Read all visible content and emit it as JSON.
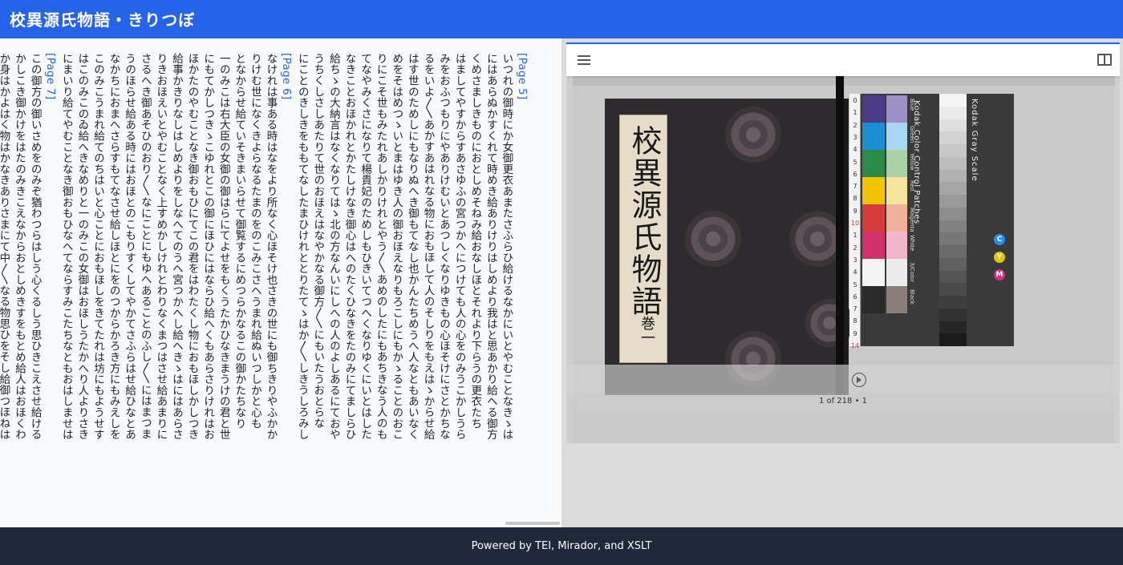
{
  "header": {
    "title": "校異源氏物語・きりつぼ"
  },
  "text": {
    "page5_label": "[Page 5]",
    "page6_label": "[Page 6]",
    "page7_label": "[Page 7]",
    "page5_lines": [
      "いつれの御時にか女御更衣あまたさふらひ給けるなかにいとやむことなきゝは",
      "にはあらぬかすくれて時めき給ありけりはしめより我はと思あかり給へる御方",
      "くめさましきものにおとしめそねみ給おなしほとそれより下らうの更衣たち",
      "はましてやすからすあさゆふの宮つかへにつけても人の心をのみうこかしうら",
      "みをおふつもりにやありけむいとあつしくなりゆきもの心ほそけにさとかちな",
      "るをいよ〳〵あかすあはれなる物におもほして人のそしりをもえはゝからせ給",
      "はす世のためしにもなりぬへき御もてなし也かんたちめうへ人なともあいなく",
      "めをそはめつゝいとまはゆき人の御おほえなりもろこしにもかゝることのおこ",
      "りにこそ世もみたれあしかりけれとやう〳〵あめのしたにもあちきなう人のも",
      "てなやみくさになりて楊貴妃のためしもひきいてつへくなりゆくにいとはした",
      "なきことおほかれとかたしけなき御心はへのたくひなきをたのみにてましらひ",
      "給ちゝの大納言はなくなりてはゝ北の方なんいにしへの人のよしあるにておや",
      "うちくしさしあたりて世のおほえはなやかなる御方〳〵にもいたうおとらな",
      "にことのきしきをももてなしたまひけれととりたてゝはか〳〵しきうしろみし"
    ],
    "page6_lines": [
      "なけれは事ある時はなをより所なく心ほそけ也さきの世にも御ちきりやふかか",
      "りけむ世になくきよらなるたまのをのこみこさへうまれ給ぬいつしかと心も",
      "となからせ給ていそきまいらせて御覧するにめつらかなるこの御かたちなり",
      "一のみこは右大臣の女御の御はらにてよせをもくうたかひなきまうけの君と世",
      "にもてかしつきゝこゆれとこの御にほひにはならひ給へくもあらさりけれはお",
      "ほかたのやむことなき御おもひにてこの君をはわたくし物におもほしかしつき",
      "給事かきりなしはしめよりをしなへてのうへ宮つかへし給へきゝはにはあらさ",
      "りきおほえいとやむことなく上すめかしけれとわりなくまつはさせ給あまりに",
      "さるへき御あそひのおり〳〵なにことにもゆへあることのふし〳〵にはまつま",
      "うのほらせ給ある時にはおほとのこもりすくしてやかてさふらはせ給ひなとあ",
      "なかちにおまへさらすもてなさせ給しほとにをのつからかろき方にもみえしを",
      "このみこうまれ給てのちはいと心ことにおもほしをきてたれは坊にもようせす",
      "はこのみこのゐ給へきなめりと一のみこの女御はおほしうたかへり人よりさき",
      "にまいり給てやむことなき御おもひなへてならすみこたちなともおはしませは"
    ],
    "page7_lines": [
      "この御方の御いさめをのみぞ猶わつらはしう心くるしう思ひきこえさせ給ける",
      "かしこき御かけをはたのみきこえなからおとしめきすをもとめ給人はおほくわ",
      "か身はかよはく物はかなきありさまにて中〳〵なる物思ひをそし給御つほねは"
    ]
  },
  "viewer": {
    "book_title": "校異源氏物語",
    "book_volume": "巻一",
    "target_kodak_gray": "Kodak Gray Scale",
    "target_kodak_color": "Kodak Color Control Patches",
    "ruler_ticks": [
      "0",
      "1",
      "2",
      "3",
      "4",
      "5",
      "6",
      "7",
      "8",
      "9",
      "10",
      "1",
      "2",
      "3",
      "4",
      "5",
      "6",
      "7",
      "8",
      "9",
      "14"
    ],
    "patch_labels": [
      "Blue",
      "Green",
      "Yellow",
      "Red",
      "Magenta",
      "White",
      "3/Color",
      "Black"
    ],
    "cym_labels": [
      "C",
      "Y",
      "M"
    ],
    "counter": "1 of 218 • 1"
  },
  "footer": {
    "text": "Powered by TEI, Mirador, and XSLT"
  },
  "colors": {
    "header": "#2563eb",
    "footer": "#1e293b",
    "page_marker": "#2563eb"
  }
}
